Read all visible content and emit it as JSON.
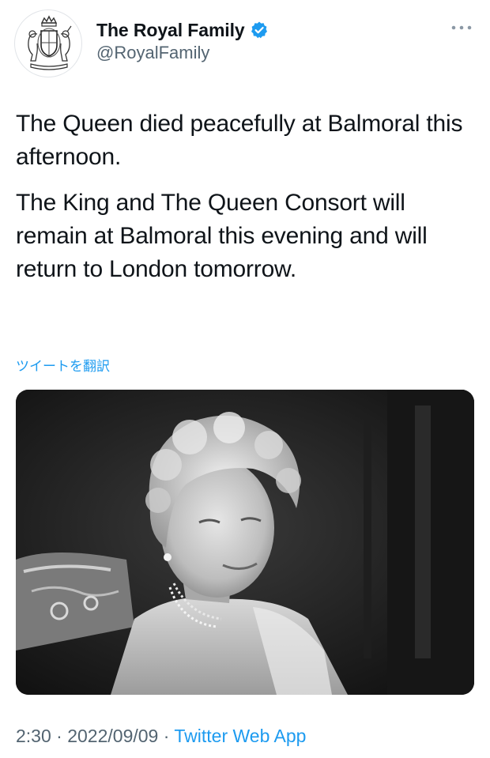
{
  "account": {
    "display_name": "The Royal Family",
    "handle": "@RoyalFamily",
    "verified": true,
    "avatar_icon": "royal-coat-of-arms-icon"
  },
  "tweet": {
    "paragraphs": [
      "The Queen died peacefully at Balmoral this afternoon.",
      "The King and The Queen Consort will remain at Balmoral this evening and will return to London tomorrow."
    ],
    "translate_label": "ツイートを翻訳",
    "media": {
      "icon": "photo-icon"
    },
    "time": "2:30",
    "separator": "·",
    "date": "2022/09/09",
    "source": "Twitter Web App"
  },
  "colors": {
    "link_blue": "#1d9bf0",
    "secondary_text": "#536471",
    "primary_text": "#0f1419"
  }
}
